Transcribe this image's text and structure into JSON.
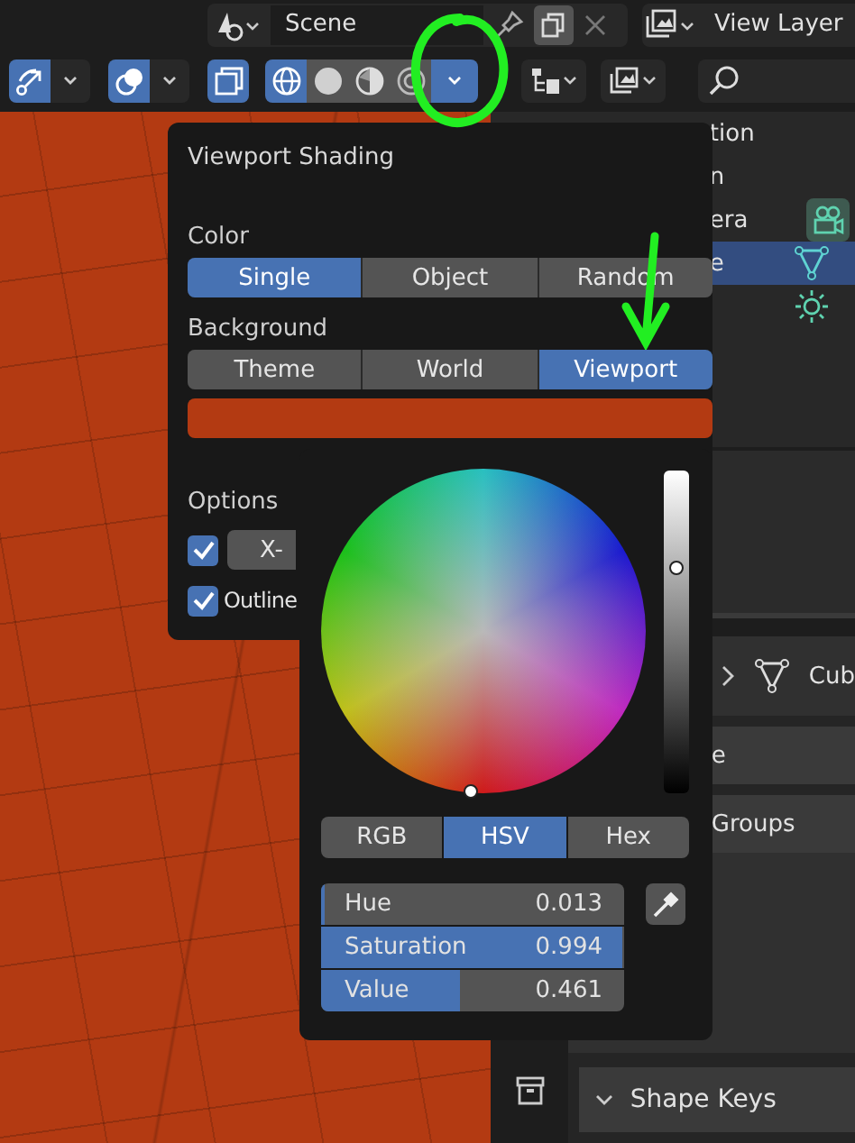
{
  "header": {
    "scene_field": {
      "value": "Scene"
    },
    "view_layer_field": {
      "value": "View Layer"
    }
  },
  "toolbar": {
    "gizmo": {
      "on": true
    },
    "overlay": {
      "on": true
    },
    "xray": {
      "on": true
    },
    "shading_modes": [
      {
        "kind": "wireframe",
        "selected": true
      },
      {
        "kind": "solid",
        "selected": false
      },
      {
        "kind": "material",
        "selected": false
      },
      {
        "kind": "rendered",
        "selected": false
      }
    ]
  },
  "outliner": {
    "rows": [
      {
        "text": "tion",
        "selected": false
      },
      {
        "text": "n",
        "selected": false
      },
      {
        "text": "era",
        "selected": false,
        "kind": "camera"
      },
      {
        "text": "e",
        "selected": true,
        "kind": "mesh"
      },
      {
        "selected": false,
        "kind": "light"
      }
    ]
  },
  "viewport_shading": {
    "title": "Viewport Shading",
    "sections": [
      {
        "label": "Color",
        "options": [
          {
            "label": "Single",
            "selected": true
          },
          {
            "label": "Object",
            "selected": false
          },
          {
            "label": "Random",
            "selected": false
          }
        ]
      },
      {
        "label": "Background",
        "options": [
          {
            "label": "Theme",
            "selected": false
          },
          {
            "label": "World",
            "selected": false
          },
          {
            "label": "Viewport",
            "selected": true
          }
        ]
      }
    ],
    "options_label": "Options",
    "options": [
      {
        "kind": "button",
        "label": "X-",
        "checked": true
      },
      {
        "kind": "label",
        "label": "Outline",
        "checked": true
      }
    ]
  },
  "color_picker": {
    "value_slider": {
      "level": 0.71
    },
    "modes": [
      {
        "label": "RGB",
        "selected": false
      },
      {
        "label": "HSV",
        "selected": true
      },
      {
        "label": "Hex",
        "selected": false
      }
    ],
    "fields": [
      {
        "label": "Hue",
        "value": "0.013",
        "level": 0.013
      },
      {
        "label": "Saturation",
        "value": "0.994",
        "level": 0.994
      },
      {
        "label": "Value",
        "value": "0.461",
        "level": 0.461
      }
    ]
  },
  "properties": {
    "object_row": {
      "text": "Cub"
    },
    "rows": [
      {
        "text": "e"
      },
      {
        "text": "Groups"
      }
    ],
    "panel": {
      "title": "Shape Keys",
      "expanded": true
    }
  }
}
